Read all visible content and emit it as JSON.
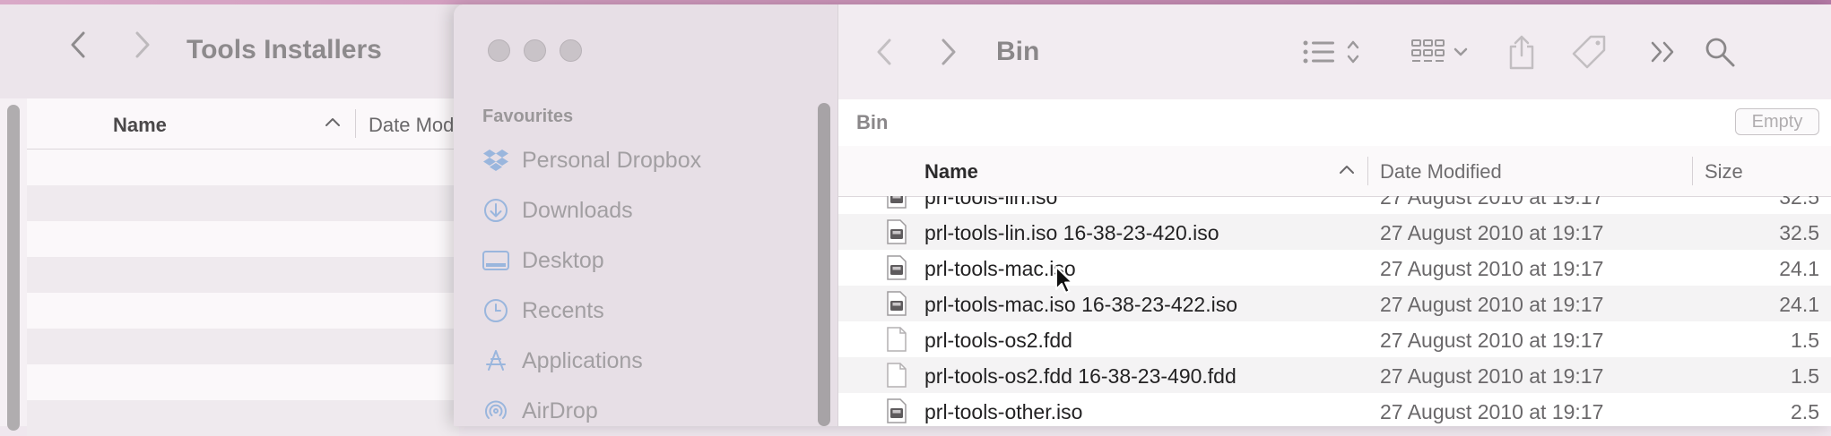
{
  "back_window": {
    "title": "Tools Installers",
    "columns": {
      "name": "Name",
      "date": "Date Mod"
    }
  },
  "sidebar": {
    "section_title": "Favourites",
    "items": [
      {
        "label": "Personal Dropbox",
        "icon": "dropbox-icon"
      },
      {
        "label": "Downloads",
        "icon": "downloads-icon"
      },
      {
        "label": "Desktop",
        "icon": "desktop-icon"
      },
      {
        "label": "Recents",
        "icon": "recents-icon"
      },
      {
        "label": "Applications",
        "icon": "applications-icon"
      },
      {
        "label": "AirDrop",
        "icon": "airdrop-icon"
      }
    ]
  },
  "window": {
    "title": "Bin",
    "path_label": "Bin",
    "empty_button": "Empty"
  },
  "columns": {
    "name": "Name",
    "date": "Date Modified",
    "size": "Size"
  },
  "files": [
    {
      "name": "prl-tools-lin.iso",
      "date": "27 August 2010 at 19:17",
      "size": "32.5",
      "icon": "disk-image-icon"
    },
    {
      "name": "prl-tools-lin.iso 16-38-23-420.iso",
      "date": "27 August 2010 at 19:17",
      "size": "32.5",
      "icon": "disk-image-icon"
    },
    {
      "name": "prl-tools-mac.iso",
      "date": "27 August 2010 at 19:17",
      "size": "24.1",
      "icon": "disk-image-icon"
    },
    {
      "name": "prl-tools-mac.iso 16-38-23-422.iso",
      "date": "27 August 2010 at 19:17",
      "size": "24.1",
      "icon": "disk-image-icon"
    },
    {
      "name": "prl-tools-os2.fdd",
      "date": "27 August 2010 at 19:17",
      "size": "1.5",
      "icon": "document-icon"
    },
    {
      "name": "prl-tools-os2.fdd 16-38-23-490.fdd",
      "date": "27 August 2010 at 19:17",
      "size": "1.5",
      "icon": "document-icon"
    },
    {
      "name": "prl-tools-other.iso",
      "date": "27 August 2010 at 19:17",
      "size": "2.5",
      "icon": "disk-image-icon"
    }
  ]
}
